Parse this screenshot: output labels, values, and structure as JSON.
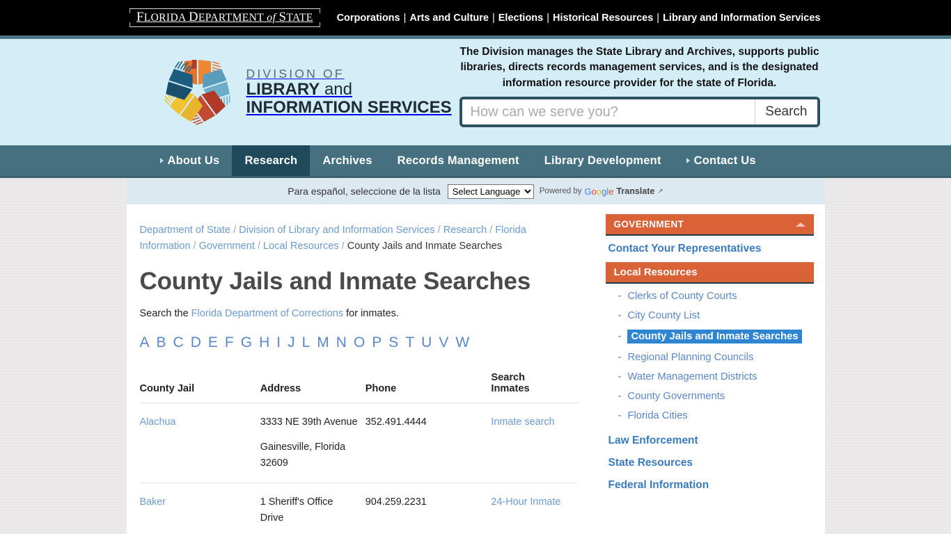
{
  "state_bar": {
    "logo_part1": "F",
    "logo_part2": "LORIDA ",
    "logo_part3": "D",
    "logo_part4": "EPARTMENT ",
    "logo_italic": "of",
    "logo_part5": " S",
    "logo_part6": "TATE",
    "logo_full": "FLORIDA DEPARTMENT of STATE",
    "links": [
      "Corporations",
      "Arts and Culture",
      "Elections",
      "Historical Resources",
      "Library and Information Services"
    ],
    "separator": "|"
  },
  "hero": {
    "brand_line1": "DIVISION OF",
    "brand_line2_bold": "LIBRARY",
    "brand_line2_rest": " and",
    "brand_line3": "INFORMATION SERVICES",
    "blurb": "The Division manages the State Library and Archives, supports public libraries, directs records management services, and is the designated information resource provider for the state of Florida.",
    "search_placeholder": "How can we serve you?",
    "search_value": "",
    "search_button": "Search"
  },
  "nav": {
    "items": [
      {
        "label": "About Us",
        "caret": true,
        "active": false
      },
      {
        "label": "Research",
        "caret": false,
        "active": true
      },
      {
        "label": "Archives",
        "caret": false,
        "active": false
      },
      {
        "label": "Records Management",
        "caret": false,
        "active": false
      },
      {
        "label": "Library Development",
        "caret": false,
        "active": false
      },
      {
        "label": "Contact Us",
        "caret": true,
        "active": false
      }
    ]
  },
  "translate": {
    "label": "Para español, seleccione de la lista",
    "select_value": "Select Language",
    "options": [
      "Select Language"
    ],
    "powered_by": "Powered by",
    "google": "Google",
    "translate_word": "Translate",
    "external_icon": "external-link-icon"
  },
  "breadcrumb": {
    "items": [
      "Department of State",
      "Division of Library and Information Services",
      "Research",
      "Florida Information",
      "Government",
      "Local Resources"
    ],
    "current": "County Jails and Inmate Searches",
    "separator": "/"
  },
  "main": {
    "title": "County Jails and Inmate Searches",
    "lead_before": "Search the ",
    "lead_link": "Florida Department of Corrections",
    "lead_after": " for inmates.",
    "alphabet": [
      "A",
      "B",
      "C",
      "D",
      "E",
      "F",
      "G",
      "H",
      "I",
      "J",
      "L",
      "M",
      "N",
      "O",
      "P",
      "S",
      "T",
      "U",
      "V",
      "W"
    ],
    "table": {
      "headers": [
        "County Jail",
        "Address",
        "Phone",
        "Search Inmates"
      ],
      "header_search_line1": "Search",
      "header_search_line2": "Inmates",
      "rows": [
        {
          "county": "Alachua",
          "address_line1": "3333 NE 39th Avenue",
          "address_line2": "Gainesville, Florida 32609",
          "phone": "352.491.4444",
          "search_link": "Inmate search"
        },
        {
          "county": "Baker",
          "address_line1": "1 Sheriff's Office Drive",
          "address_line2": "",
          "phone": "904.259.2231",
          "search_link": "24-Hour Inmate"
        }
      ]
    }
  },
  "sidebar": {
    "section_title": "GOVERNMENT",
    "collapse_icon": "chevron-up-icon",
    "top_link": "Contact Your Representatives",
    "sub_section_title": "Local Resources",
    "sub_items": [
      {
        "label": "Clerks of County Courts",
        "selected": false
      },
      {
        "label": "City County List",
        "selected": false
      },
      {
        "label": "County Jails and Inmate Searches",
        "selected": true
      },
      {
        "label": "Regional Planning Councils",
        "selected": false
      },
      {
        "label": "Water Management Districts",
        "selected": false
      },
      {
        "label": "County Governments",
        "selected": false
      },
      {
        "label": "Florida Cities",
        "selected": false
      }
    ],
    "footer_links": [
      "Law Enforcement",
      "State Resources",
      "Federal Information"
    ]
  },
  "colors": {
    "state_bar": "#000000",
    "teal_stripe": "#4a7588",
    "hero_bg": "#d4eef8",
    "nav_bg": "#44707f",
    "nav_active": "#1f4a5c",
    "accent_orange": "#d96236",
    "link_blue": "#6c9ad2",
    "selected_blue": "#2f85d0",
    "page_bg": "#eceaea"
  }
}
